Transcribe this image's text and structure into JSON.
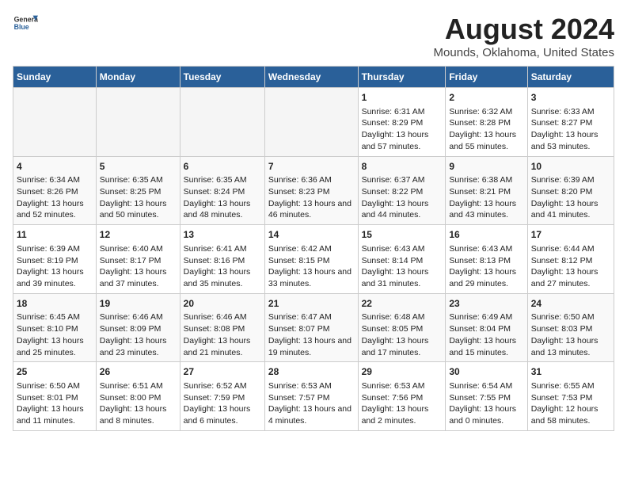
{
  "header": {
    "logo_line1": "General",
    "logo_line2": "Blue",
    "title": "August 2024",
    "subtitle": "Mounds, Oklahoma, United States"
  },
  "days_of_week": [
    "Sunday",
    "Monday",
    "Tuesday",
    "Wednesday",
    "Thursday",
    "Friday",
    "Saturday"
  ],
  "weeks": [
    [
      {
        "day": "",
        "sunrise": "",
        "sunset": "",
        "daylight": ""
      },
      {
        "day": "",
        "sunrise": "",
        "sunset": "",
        "daylight": ""
      },
      {
        "day": "",
        "sunrise": "",
        "sunset": "",
        "daylight": ""
      },
      {
        "day": "",
        "sunrise": "",
        "sunset": "",
        "daylight": ""
      },
      {
        "day": "1",
        "sunrise": "Sunrise: 6:31 AM",
        "sunset": "Sunset: 8:29 PM",
        "daylight": "Daylight: 13 hours and 57 minutes."
      },
      {
        "day": "2",
        "sunrise": "Sunrise: 6:32 AM",
        "sunset": "Sunset: 8:28 PM",
        "daylight": "Daylight: 13 hours and 55 minutes."
      },
      {
        "day": "3",
        "sunrise": "Sunrise: 6:33 AM",
        "sunset": "Sunset: 8:27 PM",
        "daylight": "Daylight: 13 hours and 53 minutes."
      }
    ],
    [
      {
        "day": "4",
        "sunrise": "Sunrise: 6:34 AM",
        "sunset": "Sunset: 8:26 PM",
        "daylight": "Daylight: 13 hours and 52 minutes."
      },
      {
        "day": "5",
        "sunrise": "Sunrise: 6:35 AM",
        "sunset": "Sunset: 8:25 PM",
        "daylight": "Daylight: 13 hours and 50 minutes."
      },
      {
        "day": "6",
        "sunrise": "Sunrise: 6:35 AM",
        "sunset": "Sunset: 8:24 PM",
        "daylight": "Daylight: 13 hours and 48 minutes."
      },
      {
        "day": "7",
        "sunrise": "Sunrise: 6:36 AM",
        "sunset": "Sunset: 8:23 PM",
        "daylight": "Daylight: 13 hours and 46 minutes."
      },
      {
        "day": "8",
        "sunrise": "Sunrise: 6:37 AM",
        "sunset": "Sunset: 8:22 PM",
        "daylight": "Daylight: 13 hours and 44 minutes."
      },
      {
        "day": "9",
        "sunrise": "Sunrise: 6:38 AM",
        "sunset": "Sunset: 8:21 PM",
        "daylight": "Daylight: 13 hours and 43 minutes."
      },
      {
        "day": "10",
        "sunrise": "Sunrise: 6:39 AM",
        "sunset": "Sunset: 8:20 PM",
        "daylight": "Daylight: 13 hours and 41 minutes."
      }
    ],
    [
      {
        "day": "11",
        "sunrise": "Sunrise: 6:39 AM",
        "sunset": "Sunset: 8:19 PM",
        "daylight": "Daylight: 13 hours and 39 minutes."
      },
      {
        "day": "12",
        "sunrise": "Sunrise: 6:40 AM",
        "sunset": "Sunset: 8:17 PM",
        "daylight": "Daylight: 13 hours and 37 minutes."
      },
      {
        "day": "13",
        "sunrise": "Sunrise: 6:41 AM",
        "sunset": "Sunset: 8:16 PM",
        "daylight": "Daylight: 13 hours and 35 minutes."
      },
      {
        "day": "14",
        "sunrise": "Sunrise: 6:42 AM",
        "sunset": "Sunset: 8:15 PM",
        "daylight": "Daylight: 13 hours and 33 minutes."
      },
      {
        "day": "15",
        "sunrise": "Sunrise: 6:43 AM",
        "sunset": "Sunset: 8:14 PM",
        "daylight": "Daylight: 13 hours and 31 minutes."
      },
      {
        "day": "16",
        "sunrise": "Sunrise: 6:43 AM",
        "sunset": "Sunset: 8:13 PM",
        "daylight": "Daylight: 13 hours and 29 minutes."
      },
      {
        "day": "17",
        "sunrise": "Sunrise: 6:44 AM",
        "sunset": "Sunset: 8:12 PM",
        "daylight": "Daylight: 13 hours and 27 minutes."
      }
    ],
    [
      {
        "day": "18",
        "sunrise": "Sunrise: 6:45 AM",
        "sunset": "Sunset: 8:10 PM",
        "daylight": "Daylight: 13 hours and 25 minutes."
      },
      {
        "day": "19",
        "sunrise": "Sunrise: 6:46 AM",
        "sunset": "Sunset: 8:09 PM",
        "daylight": "Daylight: 13 hours and 23 minutes."
      },
      {
        "day": "20",
        "sunrise": "Sunrise: 6:46 AM",
        "sunset": "Sunset: 8:08 PM",
        "daylight": "Daylight: 13 hours and 21 minutes."
      },
      {
        "day": "21",
        "sunrise": "Sunrise: 6:47 AM",
        "sunset": "Sunset: 8:07 PM",
        "daylight": "Daylight: 13 hours and 19 minutes."
      },
      {
        "day": "22",
        "sunrise": "Sunrise: 6:48 AM",
        "sunset": "Sunset: 8:05 PM",
        "daylight": "Daylight: 13 hours and 17 minutes."
      },
      {
        "day": "23",
        "sunrise": "Sunrise: 6:49 AM",
        "sunset": "Sunset: 8:04 PM",
        "daylight": "Daylight: 13 hours and 15 minutes."
      },
      {
        "day": "24",
        "sunrise": "Sunrise: 6:50 AM",
        "sunset": "Sunset: 8:03 PM",
        "daylight": "Daylight: 13 hours and 13 minutes."
      }
    ],
    [
      {
        "day": "25",
        "sunrise": "Sunrise: 6:50 AM",
        "sunset": "Sunset: 8:01 PM",
        "daylight": "Daylight: 13 hours and 11 minutes."
      },
      {
        "day": "26",
        "sunrise": "Sunrise: 6:51 AM",
        "sunset": "Sunset: 8:00 PM",
        "daylight": "Daylight: 13 hours and 8 minutes."
      },
      {
        "day": "27",
        "sunrise": "Sunrise: 6:52 AM",
        "sunset": "Sunset: 7:59 PM",
        "daylight": "Daylight: 13 hours and 6 minutes."
      },
      {
        "day": "28",
        "sunrise": "Sunrise: 6:53 AM",
        "sunset": "Sunset: 7:57 PM",
        "daylight": "Daylight: 13 hours and 4 minutes."
      },
      {
        "day": "29",
        "sunrise": "Sunrise: 6:53 AM",
        "sunset": "Sunset: 7:56 PM",
        "daylight": "Daylight: 13 hours and 2 minutes."
      },
      {
        "day": "30",
        "sunrise": "Sunrise: 6:54 AM",
        "sunset": "Sunset: 7:55 PM",
        "daylight": "Daylight: 13 hours and 0 minutes."
      },
      {
        "day": "31",
        "sunrise": "Sunrise: 6:55 AM",
        "sunset": "Sunset: 7:53 PM",
        "daylight": "Daylight: 12 hours and 58 minutes."
      }
    ]
  ]
}
